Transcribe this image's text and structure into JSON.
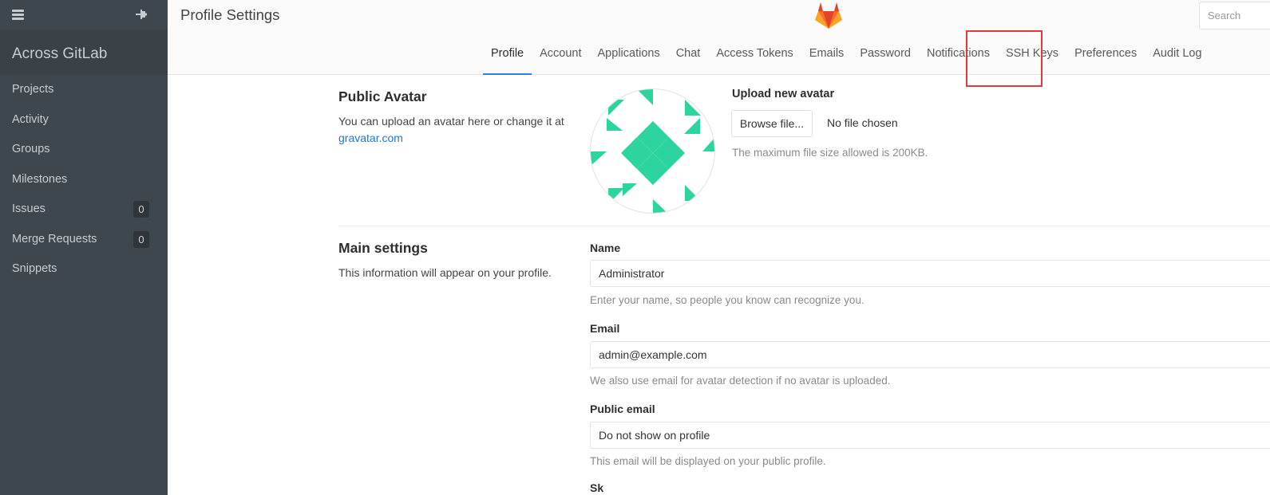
{
  "app": {
    "brand": "Across GitLab",
    "page_title": "Profile Settings"
  },
  "sidebar": {
    "items": [
      {
        "label": "Projects"
      },
      {
        "label": "Activity"
      },
      {
        "label": "Groups"
      },
      {
        "label": "Milestones"
      },
      {
        "label": "Issues",
        "badge": "0"
      },
      {
        "label": "Merge Requests",
        "badge": "0"
      },
      {
        "label": "Snippets"
      }
    ]
  },
  "search": {
    "placeholder": "Search"
  },
  "tabs": [
    {
      "label": "Profile",
      "active": true
    },
    {
      "label": "Account"
    },
    {
      "label": "Applications"
    },
    {
      "label": "Chat"
    },
    {
      "label": "Access Tokens"
    },
    {
      "label": "Emails"
    },
    {
      "label": "Password"
    },
    {
      "label": "Notifications"
    },
    {
      "label": "SSH Keys"
    },
    {
      "label": "Preferences"
    },
    {
      "label": "Audit Log"
    }
  ],
  "avatar_section": {
    "title": "Public Avatar",
    "desc": "You can upload an avatar here or change it at",
    "link": "gravatar.com",
    "upload_title": "Upload new avatar",
    "browse_label": "Browse file...",
    "no_file": "No file chosen",
    "max_size": "The maximum file size allowed is 200KB.",
    "accent_color": "#2dd4a0"
  },
  "main_settings": {
    "title": "Main settings",
    "desc": "This information will appear on your profile.",
    "name": {
      "label": "Name",
      "value": "Administrator",
      "help": "Enter your name, so people you know can recognize you."
    },
    "email": {
      "label": "Email",
      "value": "admin@example.com",
      "help": "We also use email for avatar detection if no avatar is uploaded."
    },
    "public_email": {
      "label": "Public email",
      "value": "Do not show on profile",
      "help": "This email will be displayed on your public profile."
    },
    "next_label": "Sk"
  }
}
